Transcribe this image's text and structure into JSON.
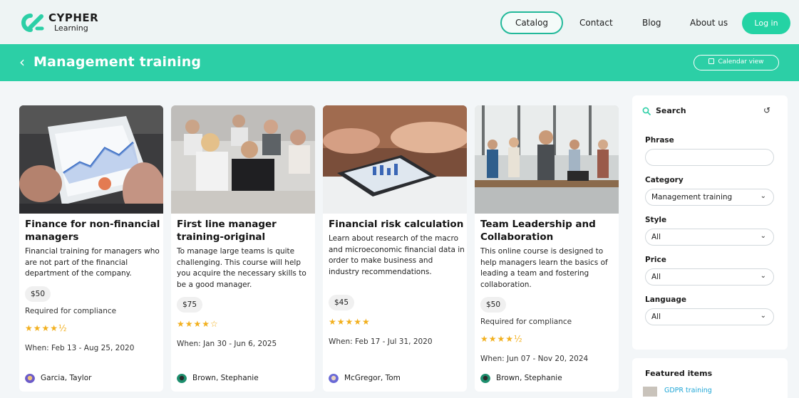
{
  "brand": {
    "line1": "CYPHER",
    "line2": "Learning",
    "accent": "#2ccfa6"
  },
  "nav": {
    "catalog": "Catalog",
    "contact": "Contact",
    "blog": "Blog",
    "about": "About us",
    "login": "Log in"
  },
  "header": {
    "title": "Management training",
    "calendar_view": "Calendar view"
  },
  "cards": [
    {
      "title": "Finance for non-financial managers",
      "description": "Financial training for managers who are not part of the financial department of the company.",
      "price": "$50",
      "required": "Required for compliance",
      "rating": 4.5,
      "stars": "★★★★½",
      "when": "When: Feb 13 - Aug 25, 2020",
      "author": "Garcia, Taylor"
    },
    {
      "title": "First line manager training-original",
      "description": "To manage large teams is quite challenging. This course will help you acquire the necessary skills to be a good manager.",
      "price": "$75",
      "required": "",
      "rating": 4,
      "stars": "★★★★☆",
      "when": "When: Jan 30 - Jun 6, 2025",
      "author": "Brown, Stephanie"
    },
    {
      "title": "Financial risk calculation",
      "description": "Learn about research of the macro and microeconomic financial data in order to make business and industry recommendations.",
      "price": "$45",
      "required": "",
      "rating": 5,
      "stars": "★★★★★",
      "when": "When: Feb 17 - Jul 31, 2020",
      "author": "McGregor, Tom"
    },
    {
      "title": "Team Leadership and Collaboration",
      "description": "This online course is designed to help managers learn the basics of leading a team and fostering collaboration.",
      "price": "$50",
      "required": "Required for compliance",
      "rating": 4.5,
      "stars": "★★★★½",
      "when": "When: Jun 07 - Nov 20, 2024",
      "author": "Brown, Stephanie"
    }
  ],
  "search": {
    "title": "Search",
    "phrase_label": "Phrase",
    "phrase_value": "",
    "category_label": "Category",
    "category_value": "Management training",
    "style_label": "Style",
    "style_value": "All",
    "price_label": "Price",
    "price_value": "All",
    "language_label": "Language",
    "language_value": "All"
  },
  "featured": {
    "title": "Featured items",
    "item": "GDPR training"
  },
  "icons": [
    "logo-icon",
    "back-chevron-icon",
    "calendar-icon",
    "search-icon",
    "reset-icon",
    "chevron-down-icon",
    "star-icon",
    "avatar"
  ]
}
